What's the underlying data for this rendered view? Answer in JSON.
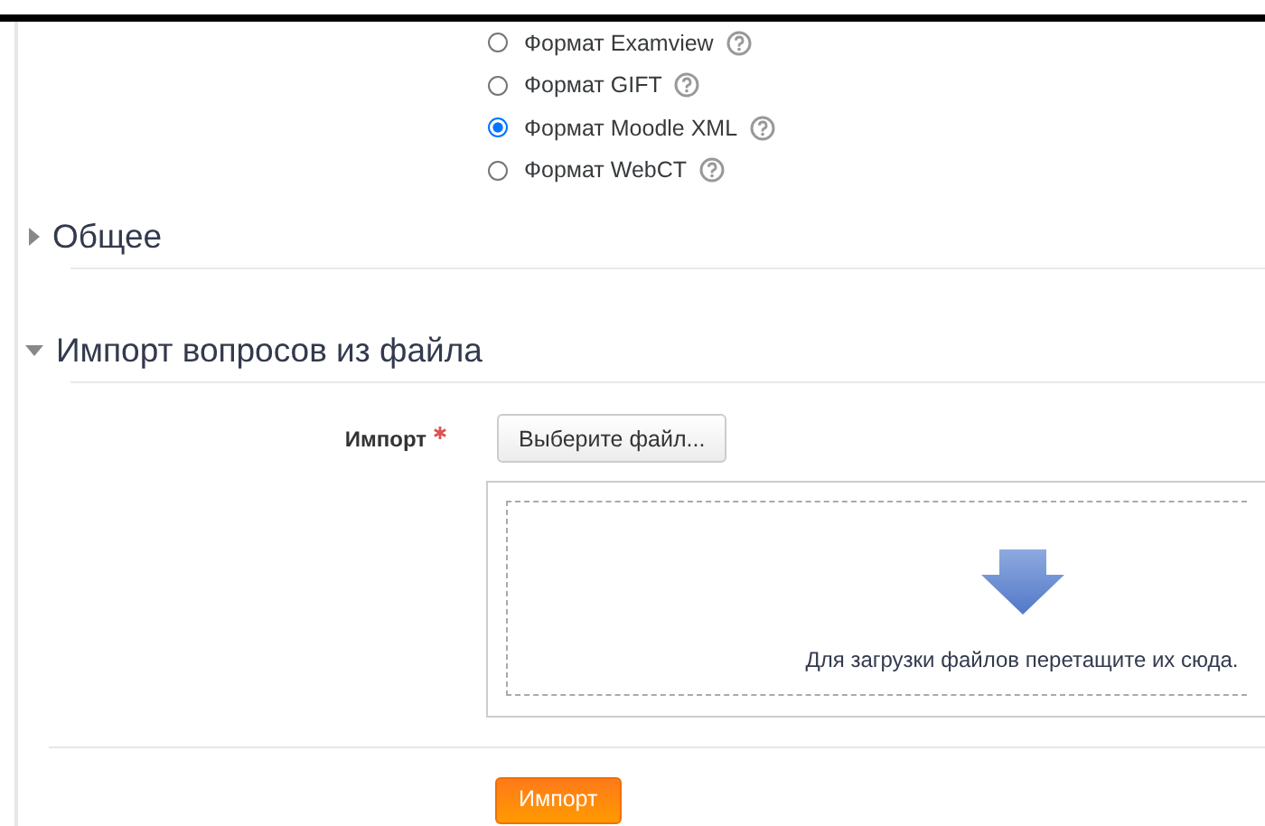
{
  "formats": [
    {
      "label": "Формат Examview",
      "selected": false
    },
    {
      "label": "Формат GIFT",
      "selected": false
    },
    {
      "label": "Формат Moodle XML",
      "selected": true
    },
    {
      "label": "Формат WebCT",
      "selected": false
    }
  ],
  "sections": [
    {
      "title": "Общее",
      "expanded": false
    },
    {
      "title": "Импорт вопросов из файла",
      "expanded": true
    }
  ],
  "import_field": {
    "label": "Импорт",
    "required": true,
    "button": "Выберите файл...",
    "dropzone_text": "Для загрузки файлов перетащите их сюда."
  },
  "submit_button": "Импорт"
}
